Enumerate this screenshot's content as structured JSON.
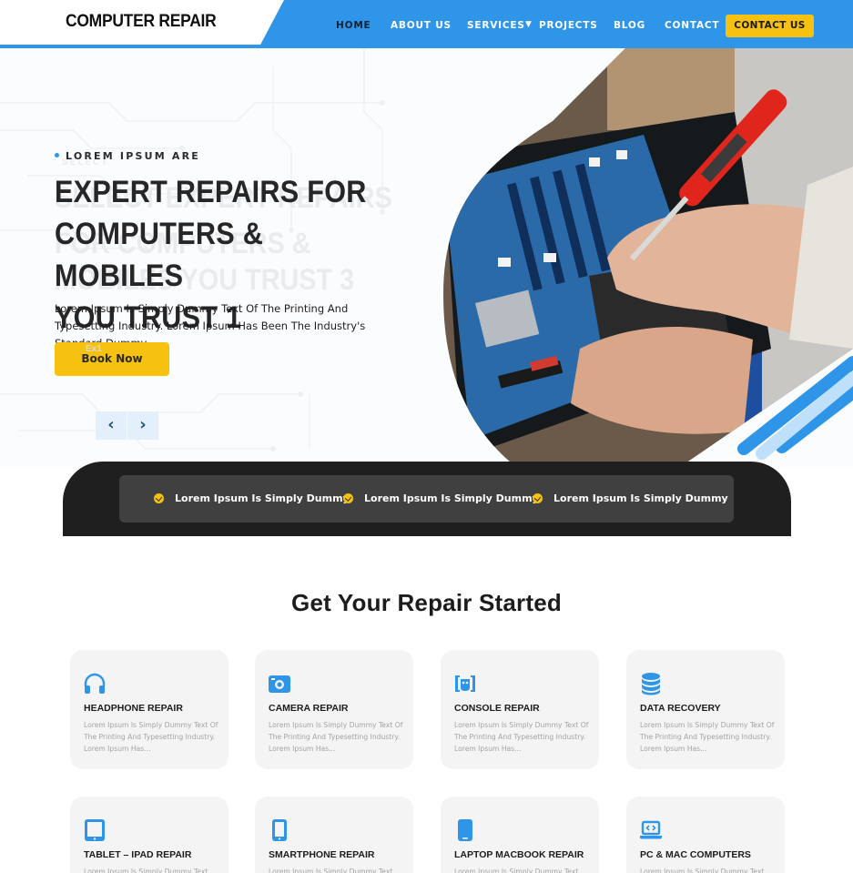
{
  "header": {
    "logo": "COMPUTER REPAIR",
    "nav": [
      "HOME",
      "ABOUT US",
      "SERVICES",
      "PROJECTS",
      "BLOG",
      "CONTACT"
    ],
    "cta": "CONTACT US"
  },
  "hero": {
    "eyebrow": "LOREM IPSUM ARE",
    "ghost_eyebrow": "SELECT",
    "title_lines": [
      "EXPERT REPAIRS FOR",
      "COMPUTERS & MOBILES",
      "YOU TRUST 1"
    ],
    "ghost_lines": [
      "SELECT EXPERT REPAIRS",
      "FOR COMPUTERS &",
      "MOBILES YOU TRUST 3"
    ],
    "text": "Lorem Ipsum Is Simply Dummy Text Of The Printing And Typesetting Industry. Lorem Ipsum Has Been The Industry's Standard Dummy .",
    "ghost_btn": "Ex1",
    "button": "Book Now",
    "prev_icon": "‹",
    "next_icon": "›"
  },
  "features": [
    "Lorem Ipsum Is Simply Dummy",
    "Lorem Ipsum Is Simply Dummy",
    "Lorem Ipsum Is Simply Dummy"
  ],
  "services": {
    "title": "Get Your Repair Started",
    "cards": [
      {
        "icon": "headphones-icon",
        "title": "HEADPHONE REPAIR",
        "desc": "Lorem Ipsum Is Simply Dummy Text Of The Printing And Typesetting Industry. Lorem Ipsum Has..."
      },
      {
        "icon": "camera-icon",
        "title": "CAMERA REPAIR",
        "desc": "Lorem Ipsum Is Simply Dummy Text Of The Printing And Typesetting Industry. Lorem Ipsum Has..."
      },
      {
        "icon": "gamepad-icon",
        "title": "CONSOLE REPAIR",
        "desc": "Lorem Ipsum Is Simply Dummy Text Of The Printing And Typesetting Industry. Lorem Ipsum Has..."
      },
      {
        "icon": "database-icon",
        "title": "DATA RECOVERY",
        "desc": "Lorem Ipsum Is Simply Dummy Text Of The Printing And Typesetting Industry. Lorem Ipsum Has..."
      },
      {
        "icon": "tablet-icon",
        "title": "TABLET –  IPAD REPAIR",
        "desc": "Lorem Ipsum Is Simply Dummy Text"
      },
      {
        "icon": "smartphone-icon",
        "title": "SMARTPHONE REPAIR",
        "desc": "Lorem Ipsum Is Simply Dummy Text"
      },
      {
        "icon": "mobile-icon",
        "title": "LAPTOP MACBOOK REPAIR",
        "desc": "Lorem Ipsum Is Simply Dummy Text"
      },
      {
        "icon": "laptop-code-icon",
        "title": "PC & MAC COMPUTERS",
        "desc": "Lorem Ipsum Is Simply Dummy Text"
      }
    ]
  },
  "colors": {
    "accent": "#2f95e8",
    "yellow": "#f6c10f",
    "dark": "#1f1f1f",
    "card_bg": "#f4f4f4"
  }
}
